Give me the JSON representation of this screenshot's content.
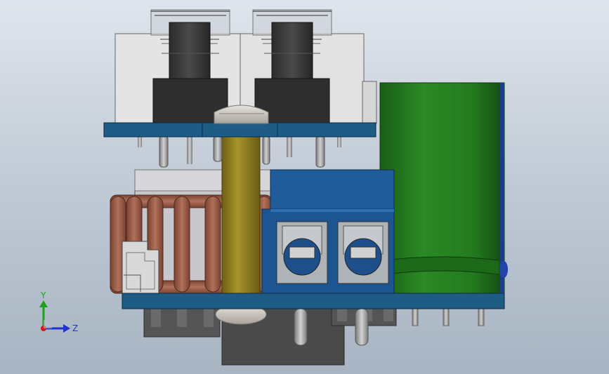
{
  "viewport": {
    "background_top": "#dfe5ec",
    "background_bottom": "#a8b4c2"
  },
  "model": {
    "parts": [
      {
        "name": "tactile-switch-left",
        "color": "#3a3a3a"
      },
      {
        "name": "tactile-switch-right",
        "color": "#3a3a3a"
      },
      {
        "name": "switch-housing-left",
        "color": "#e4e4e4"
      },
      {
        "name": "switch-housing-right",
        "color": "#e4e4e4"
      },
      {
        "name": "top-pcb",
        "color": "#1e5c86"
      },
      {
        "name": "bottom-pcb",
        "color": "#1e5c86"
      },
      {
        "name": "brass-standoff",
        "color": "#8b7a1e"
      },
      {
        "name": "screw-head",
        "color": "#c9c4bb"
      },
      {
        "name": "copper-coil",
        "color": "#9a5a44"
      },
      {
        "name": "terminal-block",
        "color": "#1f5c9a"
      },
      {
        "name": "electrolytic-capacitor",
        "color": "#237a1f"
      },
      {
        "name": "connector-bracket",
        "color": "#d8d8d8"
      },
      {
        "name": "bottom-header",
        "color": "#4a4a4a"
      }
    ]
  },
  "triad": {
    "y_label": "Y",
    "z_label": "Z",
    "y_color": "#1aa31a",
    "z_color": "#2233cc",
    "x_color": "#cc1a1a"
  }
}
